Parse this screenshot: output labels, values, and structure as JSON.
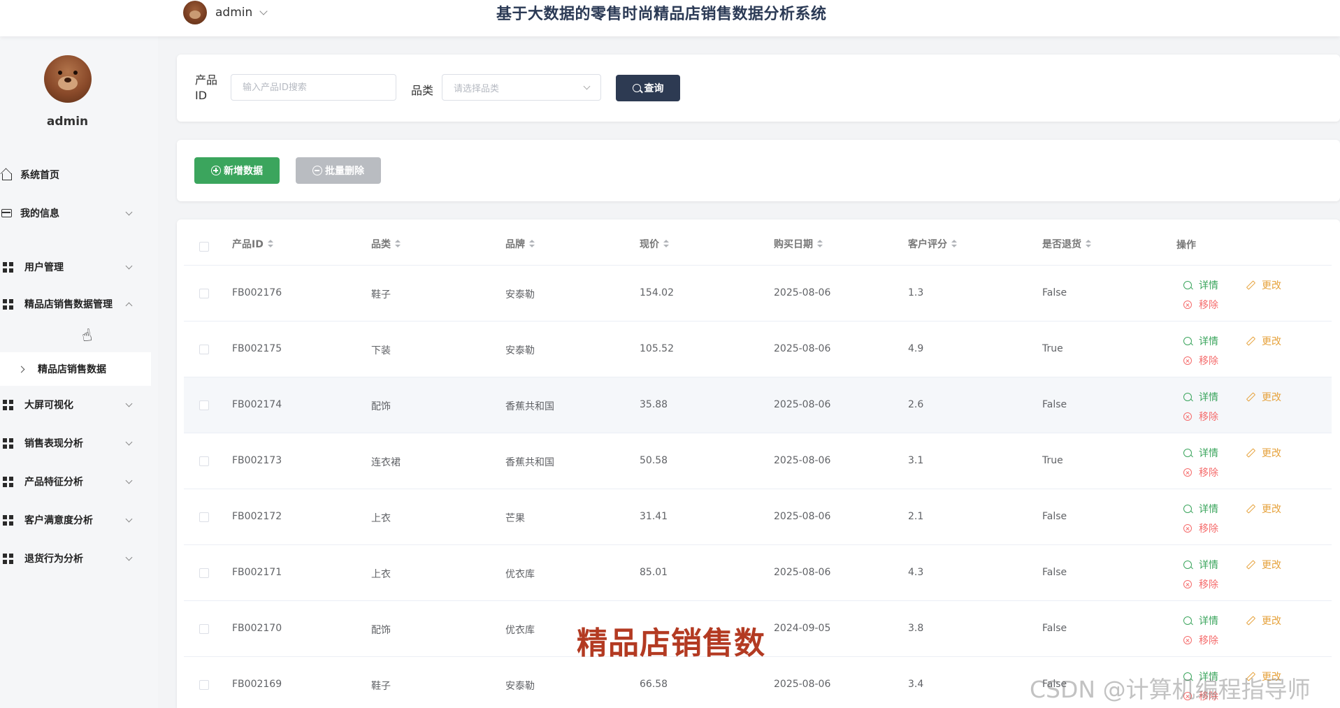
{
  "header": {
    "username": "admin",
    "system_title": "基于大数据的零售时尚精品店销售数据分析系统"
  },
  "sidebar": {
    "username": "admin",
    "items": [
      {
        "label": "系统首页",
        "icon": "home-icon",
        "has_chevron": false
      },
      {
        "label": "我的信息",
        "icon": "card-icon",
        "has_chevron": true
      },
      {
        "label": "用户管理",
        "icon": "grid-icon",
        "has_chevron": true
      },
      {
        "label": "精品店销售数据管理",
        "icon": "grid-icon",
        "has_chevron": true,
        "expanded": true
      },
      {
        "label": "大屏可视化",
        "icon": "grid-icon",
        "has_chevron": true
      },
      {
        "label": "销售表现分析",
        "icon": "grid-icon",
        "has_chevron": true
      },
      {
        "label": "产品特征分析",
        "icon": "grid-icon",
        "has_chevron": true
      },
      {
        "label": "客户满意度分析",
        "icon": "grid-icon",
        "has_chevron": true
      },
      {
        "label": "退货行为分析",
        "icon": "grid-icon",
        "has_chevron": true
      }
    ],
    "active_sub": "精品店销售数据"
  },
  "search": {
    "product_label": "产品ID",
    "product_placeholder": "输入产品ID搜索",
    "category_label": "品类",
    "category_placeholder": "请选择品类",
    "query_button": "查询"
  },
  "actions": {
    "add_button": "新增数据",
    "bulk_delete_button": "批量删除"
  },
  "table": {
    "columns": [
      "产品ID",
      "品类",
      "品牌",
      "现价",
      "购买日期",
      "客户评分",
      "是否退货",
      "操作"
    ],
    "ops": {
      "detail": "详情",
      "edit": "更改",
      "remove": "移除"
    },
    "rows": [
      {
        "id": "FB002176",
        "category": "鞋子",
        "brand": "安泰勒",
        "price": "154.02",
        "date": "2025-08-06",
        "rating": "1.3",
        "returned": "False"
      },
      {
        "id": "FB002175",
        "category": "下装",
        "brand": "安泰勒",
        "price": "105.52",
        "date": "2025-08-06",
        "rating": "4.9",
        "returned": "True"
      },
      {
        "id": "FB002174",
        "category": "配饰",
        "brand": "香蕉共和国",
        "price": "35.88",
        "date": "2025-08-06",
        "rating": "2.6",
        "returned": "False"
      },
      {
        "id": "FB002173",
        "category": "连衣裙",
        "brand": "香蕉共和国",
        "price": "50.58",
        "date": "2025-08-06",
        "rating": "3.1",
        "returned": "True"
      },
      {
        "id": "FB002172",
        "category": "上衣",
        "brand": "芒果",
        "price": "31.41",
        "date": "2025-08-06",
        "rating": "2.1",
        "returned": "False"
      },
      {
        "id": "FB002171",
        "category": "上衣",
        "brand": "优衣库",
        "price": "85.01",
        "date": "2025-08-06",
        "rating": "4.3",
        "returned": "False"
      },
      {
        "id": "FB002170",
        "category": "配饰",
        "brand": "优衣库",
        "price": "",
        "date": "2024-09-05",
        "rating": "3.8",
        "returned": "False"
      },
      {
        "id": "FB002169",
        "category": "鞋子",
        "brand": "安泰勒",
        "price": "66.58",
        "date": "2025-08-06",
        "rating": "3.4",
        "returned": "False"
      }
    ]
  },
  "overlay_caption": "精品店销售数",
  "watermark": "CSDN @计算机编程指导师",
  "colors": {
    "primary_dark": "#2d3a52",
    "success": "#3ba55d",
    "warning": "#e6a23c",
    "danger": "#f56c6c",
    "disabled": "#b9bcc1"
  }
}
